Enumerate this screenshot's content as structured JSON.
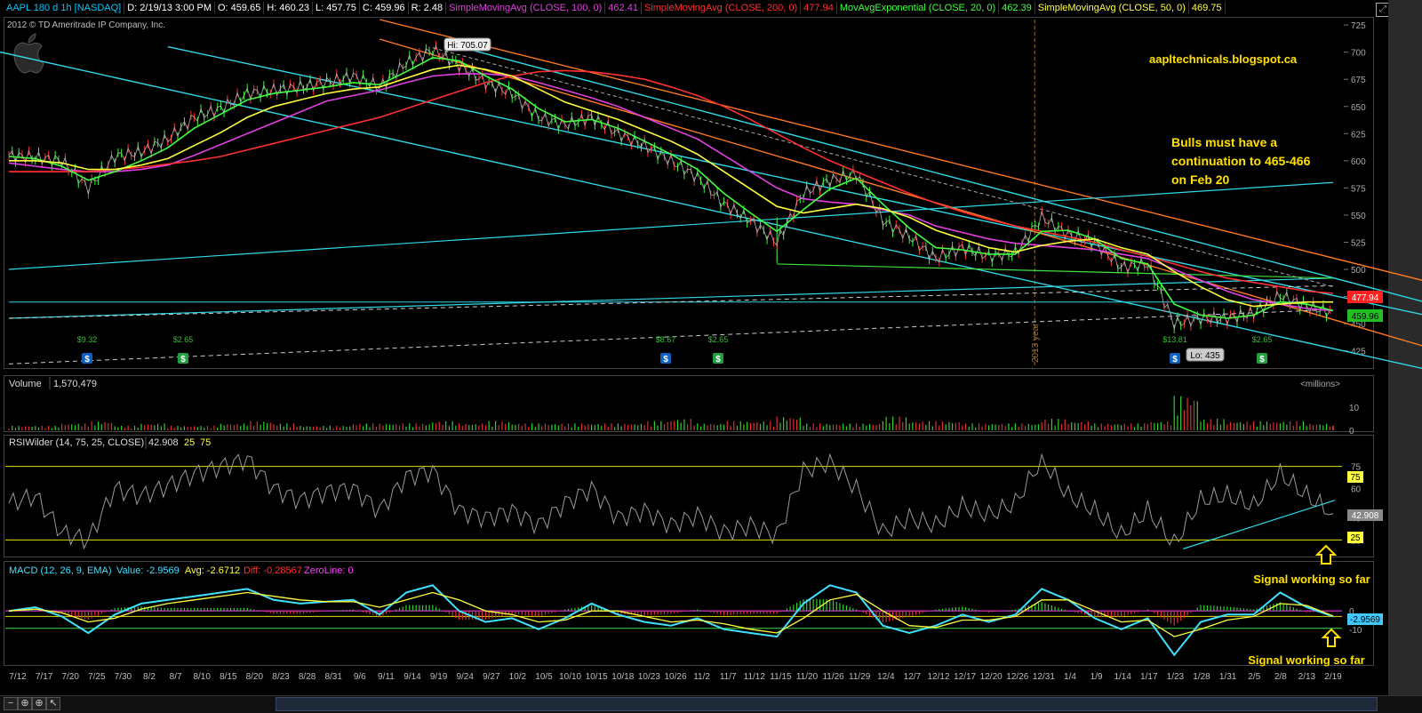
{
  "header": {
    "items": [
      {
        "text": "AAPL 180 d 1h [NASDAQ]",
        "color": "#00c8ff"
      },
      {
        "text": "D: 2/19/13 3:00 PM",
        "color": "#ffffff"
      },
      {
        "text": "O: 459.65",
        "color": "#ffffff"
      },
      {
        "text": "H: 460.23",
        "color": "#ffffff"
      },
      {
        "text": "L: 457.75",
        "color": "#ffffff"
      },
      {
        "text": "C: 459.96",
        "color": "#ffffff"
      },
      {
        "text": "R: 2.48",
        "color": "#ffffff"
      },
      {
        "text": "SimpleMovingAvg (CLOSE, 100, 0)",
        "color": "#e040e0"
      },
      {
        "text": "462.41",
        "color": "#e040e0"
      },
      {
        "text": "SimpleMovingAvg (CLOSE, 200, 0)",
        "color": "#ff3030"
      },
      {
        "text": "477.94",
        "color": "#ff3030"
      },
      {
        "text": "MovAvgExponential (CLOSE, 20, 0)",
        "color": "#40ff40"
      },
      {
        "text": "462.39",
        "color": "#40ff40"
      },
      {
        "text": "SimpleMovingAvg (CLOSE, 50, 0)",
        "color": "#ffff40"
      },
      {
        "text": "469.75",
        "color": "#ffff40"
      }
    ]
  },
  "copyright": "2012 © TD Ameritrade IP Company, Inc.",
  "annotations": {
    "blog": "aapltechnicals.blogspot.ca",
    "note_line1": "Bulls must have a",
    "note_line2": "continuation to 465-466",
    "note_line3": "on Feb 20",
    "signal1": "Signal working so far",
    "signal2": "Signal working so far",
    "year_marker": "2013 year",
    "hi_label": "Hi: 705.07",
    "lo_label": "Lo: 435"
  },
  "price_axis": {
    "ticks": [
      725,
      700,
      675,
      650,
      625,
      600,
      575,
      550,
      525,
      500,
      475,
      450,
      425
    ],
    "badge_sma200": "477.94",
    "badge_close": "459.96",
    "badge_sma200_color": "#ff2020",
    "badge_close_color": "#20c020"
  },
  "dividends": [
    {
      "label": "$9.32",
      "x_index": 0
    },
    {
      "label": "$2.65",
      "x_index": 1
    },
    {
      "label": "$8.67",
      "x_index": 2
    },
    {
      "label": "$2.65",
      "x_index": 3
    },
    {
      "label": "$13.81",
      "x_index": 4
    },
    {
      "label": "$2.65",
      "x_index": 5
    }
  ],
  "volume": {
    "title": "Volume",
    "value": "1,570,479",
    "unit": "<millions>",
    "ticks": [
      10,
      0
    ]
  },
  "rsi": {
    "title": "RSIWilder (14, 75, 25, CLOSE)",
    "value": "42.908",
    "low": "25",
    "high": "75",
    "ticks": [
      75,
      60,
      40,
      25
    ],
    "badge": "42.908"
  },
  "macd": {
    "title": "MACD (12, 26, 9, EMA)",
    "value": "Value: -2.9569",
    "avg": "Avg: -2.6712",
    "diff": "Diff: -0.28567",
    "zeroline": "ZeroLine: 0",
    "ticks": [
      0,
      -10
    ],
    "badge": "-2.9569"
  },
  "x_axis": {
    "labels": [
      "7/12",
      "7/17",
      "7/20",
      "7/25",
      "7/30",
      "8/2",
      "8/7",
      "8/10",
      "8/15",
      "8/20",
      "8/23",
      "8/28",
      "8/31",
      "9/6",
      "9/11",
      "9/14",
      "9/19",
      "9/24",
      "9/27",
      "10/2",
      "10/5",
      "10/10",
      "10/15",
      "10/18",
      "10/23",
      "10/26",
      "11/2",
      "11/7",
      "11/12",
      "11/15",
      "11/20",
      "11/26",
      "11/29",
      "12/4",
      "12/7",
      "12/12",
      "12/17",
      "12/20",
      "12/26",
      "12/31",
      "1/4",
      "1/9",
      "1/14",
      "1/17",
      "1/23",
      "1/28",
      "1/31",
      "2/5",
      "2/8",
      "2/13",
      "2/19"
    ]
  },
  "chart_data": [
    {
      "type": "line",
      "title": "AAPL 180 d 1h [NASDAQ]",
      "description_axis": "price",
      "x": [
        "7/12",
        "7/17",
        "7/20",
        "7/25",
        "7/30",
        "8/2",
        "8/7",
        "8/10",
        "8/15",
        "8/20",
        "8/23",
        "8/28",
        "8/31",
        "9/6",
        "9/11",
        "9/14",
        "9/19",
        "9/24",
        "9/27",
        "10/2",
        "10/5",
        "10/10",
        "10/15",
        "10/18",
        "10/23",
        "10/26",
        "11/2",
        "11/7",
        "11/12",
        "11/15",
        "11/20",
        "11/26",
        "11/29",
        "12/4",
        "12/7",
        "12/12",
        "12/17",
        "12/20",
        "12/26",
        "12/31",
        "1/4",
        "1/9",
        "1/14",
        "1/17",
        "1/23",
        "1/28",
        "1/31",
        "2/5",
        "2/8",
        "2/13",
        "2/19"
      ],
      "series": [
        {
          "name": "AAPL",
          "color": "#ffffff",
          "values": [
            605,
            603,
            600,
            575,
            604,
            608,
            620,
            640,
            648,
            662,
            665,
            668,
            672,
            678,
            668,
            690,
            702,
            688,
            672,
            662,
            640,
            633,
            640,
            625,
            614,
            600,
            585,
            560,
            545,
            525,
            570,
            582,
            588,
            545,
            530,
            510,
            520,
            512,
            515,
            548,
            532,
            525,
            502,
            505,
            450,
            455,
            455,
            460,
            476,
            466,
            460
          ]
        },
        {
          "name": "SimpleMovingAvg (CLOSE, 100, 0)",
          "color": "#e040e0",
          "values": [
            598,
            595,
            592,
            590,
            590,
            592,
            596,
            605,
            615,
            625,
            635,
            645,
            655,
            660,
            665,
            672,
            678,
            680,
            680,
            678,
            672,
            665,
            658,
            650,
            640,
            630,
            620,
            605,
            590,
            575,
            565,
            562,
            560,
            555,
            550,
            540,
            534,
            528,
            524,
            522,
            520,
            518,
            514,
            510,
            500,
            490,
            480,
            472,
            468,
            464,
            462
          ]
        },
        {
          "name": "SimpleMovingAvg (CLOSE, 200, 0)",
          "color": "#ff3030",
          "values": [
            590,
            590,
            590,
            590,
            592,
            594,
            597,
            600,
            604,
            610,
            616,
            622,
            628,
            634,
            640,
            648,
            656,
            664,
            672,
            678,
            682,
            683,
            682,
            679,
            675,
            668,
            660,
            650,
            638,
            625,
            612,
            600,
            590,
            580,
            570,
            561,
            553,
            546,
            540,
            535,
            530,
            525,
            518,
            512,
            505,
            498,
            492,
            488,
            484,
            480,
            478
          ]
        },
        {
          "name": "MovAvgExponential (CLOSE, 20, 0)",
          "color": "#40ff40",
          "values": [
            604,
            602,
            595,
            582,
            590,
            600,
            612,
            630,
            643,
            656,
            662,
            665,
            668,
            672,
            670,
            682,
            695,
            692,
            678,
            666,
            648,
            636,
            638,
            630,
            618,
            606,
            592,
            570,
            552,
            535,
            555,
            574,
            584,
            560,
            538,
            520,
            518,
            514,
            514,
            535,
            536,
            528,
            510,
            505,
            468,
            458,
            455,
            458,
            470,
            468,
            462
          ]
        },
        {
          "name": "SimpleMovingAvg (CLOSE, 50, 0)",
          "color": "#ffff40",
          "values": [
            600,
            600,
            598,
            592,
            592,
            596,
            602,
            614,
            626,
            640,
            650,
            656,
            662,
            666,
            668,
            676,
            684,
            688,
            684,
            678,
            666,
            654,
            646,
            638,
            628,
            618,
            606,
            590,
            574,
            558,
            552,
            556,
            560,
            556,
            548,
            536,
            528,
            520,
            516,
            522,
            526,
            528,
            520,
            514,
            498,
            484,
            472,
            466,
            468,
            470,
            470
          ]
        }
      ],
      "ylim": [
        410,
        730
      ]
    },
    {
      "type": "bar",
      "title": "Volume",
      "x": [
        "7/12",
        "7/17",
        "7/20",
        "7/25",
        "7/30",
        "8/2",
        "8/7",
        "8/10",
        "8/15",
        "8/20",
        "8/23",
        "8/28",
        "8/31",
        "9/6",
        "9/11",
        "9/14",
        "9/19",
        "9/24",
        "9/27",
        "10/2",
        "10/5",
        "10/10",
        "10/15",
        "10/18",
        "10/23",
        "10/26",
        "11/2",
        "11/7",
        "11/12",
        "11/15",
        "11/20",
        "11/26",
        "11/29",
        "12/4",
        "12/7",
        "12/12",
        "12/17",
        "12/20",
        "12/26",
        "12/31",
        "1/4",
        "1/9",
        "1/14",
        "1/17",
        "1/23",
        "1/28",
        "1/31",
        "2/5",
        "2/8",
        "2/13",
        "2/19"
      ],
      "series": [
        {
          "name": "Volume",
          "values": [
            2,
            2,
            3,
            4,
            2,
            3,
            2,
            2,
            3,
            4,
            3,
            2,
            2,
            3,
            3,
            3,
            4,
            3,
            4,
            3,
            3,
            3,
            3,
            3,
            4,
            5,
            3,
            4,
            4,
            6,
            3,
            3,
            3,
            6,
            4,
            4,
            3,
            3,
            3,
            5,
            4,
            3,
            3,
            4,
            15,
            5,
            4,
            4,
            4,
            3,
            2
          ]
        }
      ],
      "ylim": [
        0,
        17
      ]
    },
    {
      "type": "line",
      "title": "RSIWilder (14, 75, 25, CLOSE)",
      "x": [
        "7/12",
        "7/17",
        "7/20",
        "7/25",
        "7/30",
        "8/2",
        "8/7",
        "8/10",
        "8/15",
        "8/20",
        "8/23",
        "8/28",
        "8/31",
        "9/6",
        "9/11",
        "9/14",
        "9/19",
        "9/24",
        "9/27",
        "10/2",
        "10/5",
        "10/10",
        "10/15",
        "10/18",
        "10/23",
        "10/26",
        "11/2",
        "11/7",
        "11/12",
        "11/15",
        "11/20",
        "11/26",
        "11/29",
        "12/4",
        "12/7",
        "12/12",
        "12/17",
        "12/20",
        "12/26",
        "12/31",
        "1/4",
        "1/9",
        "1/14",
        "1/17",
        "1/23",
        "1/28",
        "1/31",
        "2/5",
        "2/8",
        "2/13",
        "2/19"
      ],
      "series": [
        {
          "name": "RSI",
          "values": [
            50,
            55,
            30,
            25,
            60,
            55,
            62,
            70,
            75,
            80,
            60,
            52,
            58,
            60,
            45,
            68,
            72,
            45,
            40,
            45,
            35,
            50,
            60,
            40,
            45,
            35,
            42,
            30,
            35,
            28,
            72,
            78,
            60,
            30,
            40,
            35,
            48,
            42,
            50,
            80,
            55,
            45,
            28,
            45,
            22,
            52,
            55,
            48,
            70,
            55,
            43
          ]
        }
      ],
      "ylim": [
        15,
        85
      ]
    },
    {
      "type": "line",
      "title": "MACD (12, 26, 9, EMA)",
      "x": [
        "7/12",
        "7/17",
        "7/20",
        "7/25",
        "7/30",
        "8/2",
        "8/7",
        "8/10",
        "8/15",
        "8/20",
        "8/23",
        "8/28",
        "8/31",
        "9/6",
        "9/11",
        "9/14",
        "9/19",
        "9/24",
        "9/27",
        "10/2",
        "10/5",
        "10/10",
        "10/15",
        "10/18",
        "10/23",
        "10/26",
        "11/2",
        "11/7",
        "11/12",
        "11/15",
        "11/20",
        "11/26",
        "11/29",
        "12/4",
        "12/7",
        "12/12",
        "12/17",
        "12/20",
        "12/26",
        "12/31",
        "1/4",
        "1/9",
        "1/14",
        "1/17",
        "1/23",
        "1/28",
        "1/31",
        "2/5",
        "2/8",
        "2/13",
        "2/19"
      ],
      "series": [
        {
          "name": "Value",
          "color": "#40e0ff",
          "values": [
            0,
            2,
            -3,
            -12,
            -2,
            4,
            6,
            8,
            10,
            12,
            6,
            4,
            5,
            6,
            -2,
            10,
            14,
            0,
            -6,
            -4,
            -10,
            -4,
            4,
            -2,
            -6,
            -8,
            -4,
            -10,
            -12,
            -14,
            4,
            14,
            10,
            -8,
            -12,
            -8,
            -2,
            -6,
            -2,
            12,
            6,
            -4,
            -10,
            -4,
            -24,
            -6,
            -2,
            -2,
            10,
            2,
            -3
          ]
        },
        {
          "name": "Avg",
          "color": "#ffff40",
          "values": [
            0,
            1,
            -1,
            -6,
            -4,
            1,
            4,
            6,
            8,
            10,
            8,
            6,
            5,
            5,
            2,
            6,
            10,
            6,
            0,
            -2,
            -6,
            -5,
            0,
            0,
            -3,
            -6,
            -5,
            -7,
            -10,
            -12,
            -4,
            6,
            9,
            0,
            -8,
            -9,
            -5,
            -5,
            -3,
            6,
            6,
            0,
            -6,
            -5,
            -14,
            -10,
            -5,
            -3,
            4,
            3,
            -2.7
          ]
        }
      ],
      "ylim": [
        -28,
        18
      ]
    }
  ]
}
